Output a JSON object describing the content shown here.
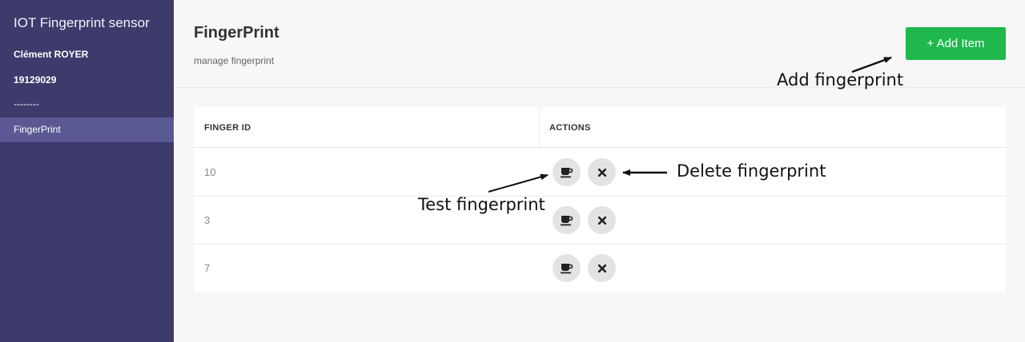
{
  "sidebar": {
    "app_title": "IOT Fingerprint sensor",
    "user_name": "Clément ROYER",
    "user_id": "19129029",
    "separator": "--------",
    "nav_items": [
      {
        "label": "FingerPrint",
        "active": true
      }
    ]
  },
  "header": {
    "title": "FingerPrint",
    "subtitle": "manage fingerprint",
    "add_button_label": "+ Add Item"
  },
  "table": {
    "columns": [
      "FINGER ID",
      "ACTIONS"
    ],
    "rows": [
      {
        "finger_id": "10",
        "actions": [
          "test-icon",
          "delete-icon"
        ]
      },
      {
        "finger_id": "3",
        "actions": [
          "test-icon",
          "delete-icon"
        ]
      },
      {
        "finger_id": "7",
        "actions": [
          "test-icon",
          "delete-icon"
        ]
      }
    ]
  },
  "annotations": {
    "add": "Add fingerprint",
    "delete": "Delete fingerprint",
    "test": "Test fingerprint"
  },
  "colors": {
    "sidebar_bg": "#3d3b6b",
    "sidebar_active": "#5b5993",
    "accent_green": "#1fb84c",
    "icon_button_bg": "#e3e3e3"
  }
}
